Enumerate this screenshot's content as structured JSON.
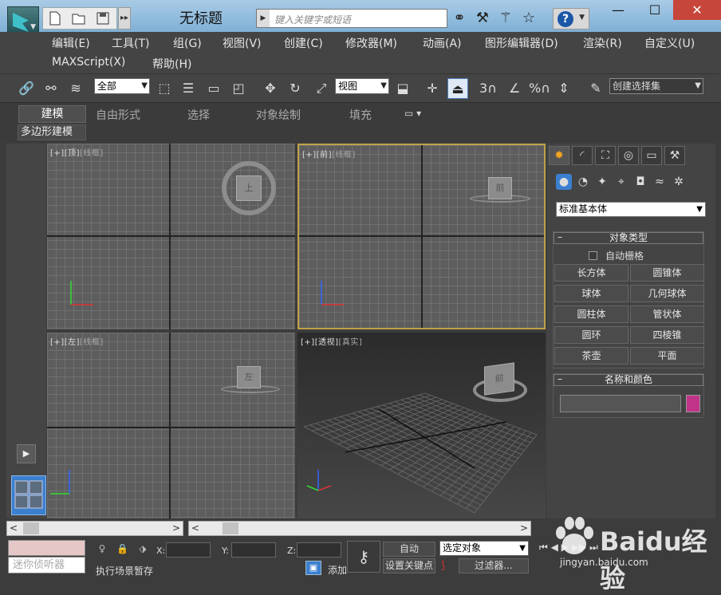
{
  "window": {
    "title": "无标题",
    "search_placeholder": "键入关键字或短语"
  },
  "menus": {
    "row1": [
      "编辑(E)",
      "工具(T)",
      "组(G)",
      "视图(V)",
      "创建(C)",
      "修改器(M)",
      "动画(A)",
      "图形编辑器(D)",
      "渲染(R)",
      "自定义(U)"
    ],
    "row2": [
      "MAXScript(X)",
      "帮助(H)"
    ]
  },
  "toolbar": {
    "selection_filter": "全部",
    "ref_coord": "视图",
    "snap_label_3": "3",
    "percent_label": "%",
    "named_selection": "创建选择集"
  },
  "ribbon": {
    "tabs": [
      "建模",
      "自由形式",
      "选择",
      "对象绘制",
      "填充"
    ],
    "active_tab": "建模",
    "sub_panel": "多边形建模"
  },
  "viewports": [
    {
      "id": "top",
      "plus": "[+]",
      "view": "[顶]",
      "mode": "[线框]",
      "cube": "上"
    },
    {
      "id": "front",
      "plus": "[+]",
      "view": "[前]",
      "mode": "[线框]",
      "cube": "前"
    },
    {
      "id": "left",
      "plus": "[+]",
      "view": "[左]",
      "mode": "[线框]",
      "cube": "左"
    },
    {
      "id": "persp",
      "plus": "[+]",
      "view": "[透视]",
      "mode": "[真实]",
      "cube": "前"
    }
  ],
  "command_panel": {
    "category": "标准基本体",
    "rollout_object_type": "对象类型",
    "auto_grid": "自动栅格",
    "objects": [
      "长方体",
      "圆锥体",
      "球体",
      "几何球体",
      "圆柱体",
      "管状体",
      "圆环",
      "四棱锥",
      "茶壶",
      "平面"
    ],
    "rollout_name_color": "名称和颜色",
    "object_color": "#c2338a"
  },
  "statusbar": {
    "maxscript_hint": "迷你侦听器",
    "message": "执行场景暂存",
    "add_label": "添加",
    "x_label": "X:",
    "y_label": "Y:",
    "z_label": "Z:",
    "auto_key": "自动",
    "set_key": "设置关键点",
    "selected_objects": "选定对象",
    "filters": "过滤器..."
  },
  "watermark": {
    "brand": "Baidu经验",
    "url": "jingyan.baidu.com"
  },
  "colors": {
    "title_bar": "#8ebcdf",
    "accent_blue": "#3b7fcf",
    "active_viewport_border": "#bfa247"
  }
}
